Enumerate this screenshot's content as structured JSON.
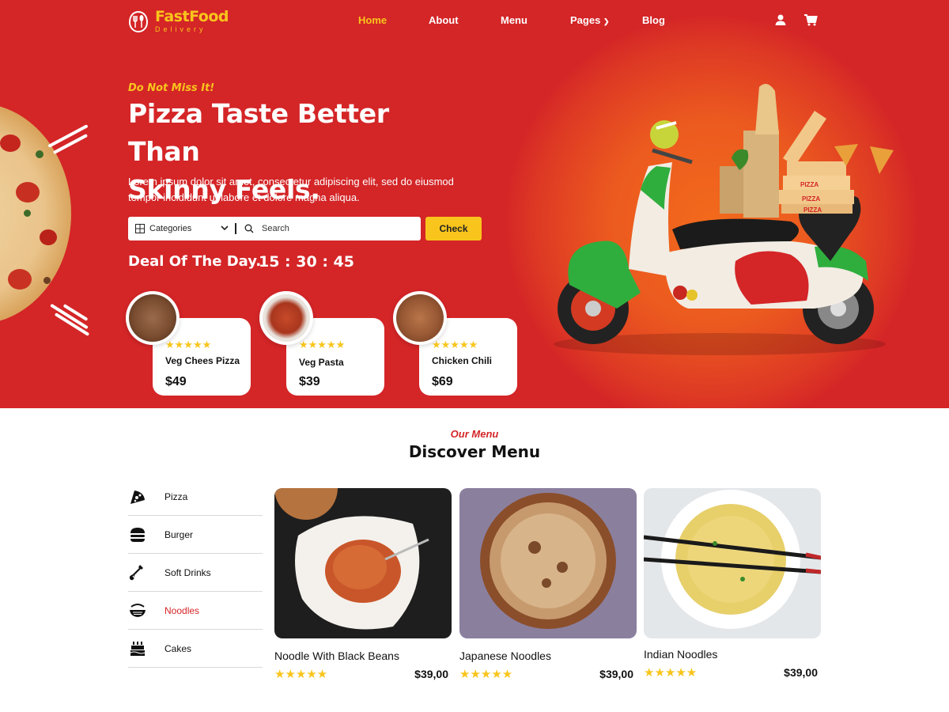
{
  "brand": {
    "name": "FastFood",
    "tagline": "Delivery"
  },
  "nav": {
    "items": [
      {
        "label": "Home",
        "active": true
      },
      {
        "label": "About"
      },
      {
        "label": "Menu"
      },
      {
        "label": "Pages",
        "dropdown": true
      },
      {
        "label": "Blog"
      }
    ],
    "icons": [
      "user-icon",
      "cart-icon"
    ]
  },
  "hero": {
    "kicker": "Do Not Miss It!",
    "headline_line1": "Pizza Taste Better Than",
    "headline_line2": "Skinny Feels.",
    "lead_line1": "Lorem ipsum dolor sit amet, consectetur adipiscing elit, sed do eiusmod",
    "lead_line2": "tempor incididunt ut labore et dolore magna aliqua."
  },
  "search": {
    "category_label": "Categories",
    "placeholder": "Search",
    "button": "Check"
  },
  "deal": {
    "label": "Deal Of The Day.",
    "timer": "15 : 30 : 45",
    "items": [
      {
        "name": "Veg Chees Pizza",
        "price": "$49",
        "rating": 5
      },
      {
        "name": "Veg Pasta",
        "price": "$39",
        "rating": 5
      },
      {
        "name": "Chicken Chili",
        "price": "$69",
        "rating": 5
      }
    ]
  },
  "menu": {
    "kicker": "Our Menu",
    "title": "Discover Menu",
    "categories": [
      {
        "label": "Pizza",
        "icon": "pizza-icon"
      },
      {
        "label": "Burger",
        "icon": "burger-icon"
      },
      {
        "label": "Soft Drinks",
        "icon": "bottle-icon"
      },
      {
        "label": "Noodles",
        "icon": "noodle-bowl-icon",
        "active": true
      },
      {
        "label": "Cakes",
        "icon": "cake-icon"
      }
    ],
    "dishes": [
      {
        "name": "Noodle With Black Beans",
        "price": "$39,00",
        "rating": 5
      },
      {
        "name": "Japanese Noodles",
        "price": "$39,00",
        "rating": 5
      },
      {
        "name": "Indian Noodles",
        "price": "$39,00",
        "rating": 5
      }
    ]
  },
  "colors": {
    "primary_red": "#d42527",
    "accent_yellow": "#f9c51c",
    "orange_glow": "#f26a1c"
  }
}
